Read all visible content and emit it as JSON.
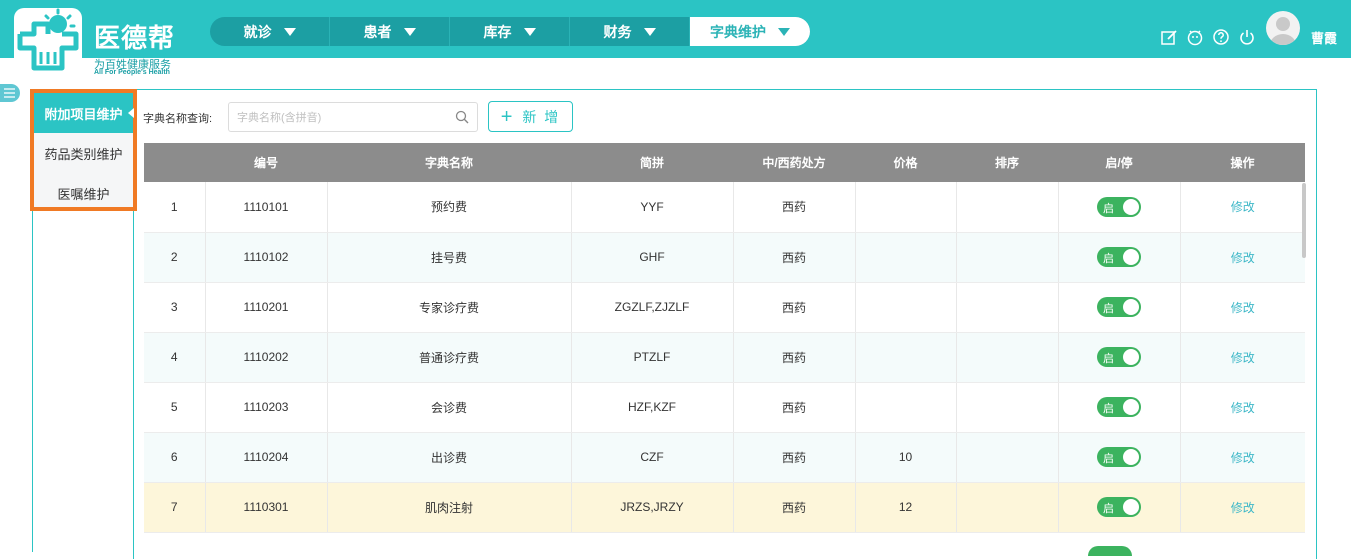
{
  "app": {
    "logo_title": "医德帮",
    "logo_subtitle": "为百姓健康服务",
    "logo_slogan": "All For People's Health",
    "user_name": "曹霞"
  },
  "nav": [
    {
      "label": "就诊",
      "active": false
    },
    {
      "label": "患者",
      "active": false
    },
    {
      "label": "库存",
      "active": false
    },
    {
      "label": "财务",
      "active": false
    },
    {
      "label": "字典维护",
      "active": true
    }
  ],
  "sidebar": {
    "items": [
      {
        "label": "附加项目维护",
        "active": true
      },
      {
        "label": "药品类别维护",
        "active": false
      },
      {
        "label": "医嘱维护",
        "active": false
      }
    ]
  },
  "search": {
    "label": "字典名称查询:",
    "placeholder": "字典名称(含拼音)",
    "value": ""
  },
  "add_button": {
    "label": "新 增"
  },
  "table": {
    "headers": [
      "",
      "编号",
      "字典名称",
      "简拼",
      "中/西药处方",
      "价格",
      "排序",
      "启/停",
      "操作"
    ],
    "toggle_label": "启",
    "edit_label": "修改",
    "rows": [
      {
        "no": "1",
        "code": "1110101",
        "name": "预约费",
        "abbr": "YYF",
        "type": "西药",
        "price": "",
        "sort": "",
        "enabled": true
      },
      {
        "no": "2",
        "code": "1110102",
        "name": "挂号费",
        "abbr": "GHF",
        "type": "西药",
        "price": "",
        "sort": "",
        "enabled": true
      },
      {
        "no": "3",
        "code": "1110201",
        "name": "专家诊疗费",
        "abbr": "ZGZLF,ZJZLF",
        "type": "西药",
        "price": "",
        "sort": "",
        "enabled": true
      },
      {
        "no": "4",
        "code": "1110202",
        "name": "普通诊疗费",
        "abbr": "PTZLF",
        "type": "西药",
        "price": "",
        "sort": "",
        "enabled": true
      },
      {
        "no": "5",
        "code": "1110203",
        "name": "会诊费",
        "abbr": "HZF,KZF",
        "type": "西药",
        "price": "",
        "sort": "",
        "enabled": true
      },
      {
        "no": "6",
        "code": "1110204",
        "name": "出诊费",
        "abbr": "CZF",
        "type": "西药",
        "price": "10",
        "sort": "",
        "enabled": true
      },
      {
        "no": "7",
        "code": "1110301",
        "name": "肌肉注射",
        "abbr": "JRZS,JRZY",
        "type": "西药",
        "price": "12",
        "sort": "",
        "enabled": true
      }
    ]
  },
  "colors": {
    "brand": "#2bc4c4",
    "nav_dark": "#1c9fa3",
    "toggle_on": "#3cb35f",
    "highlight_row": "#fdf6da",
    "sidebar_outline": "#f07a24"
  }
}
